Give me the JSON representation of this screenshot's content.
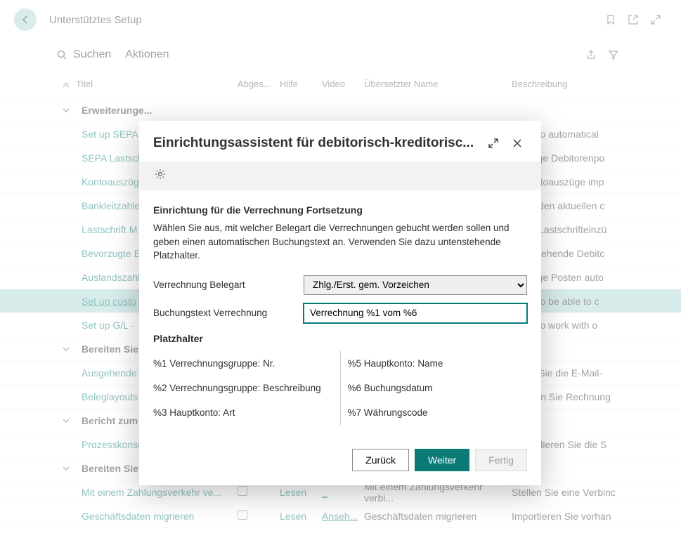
{
  "header": {
    "page_title": "Unterstütztes Setup"
  },
  "actionbar": {
    "search_label": "Suchen",
    "actions_label": "Aktionen"
  },
  "columns": {
    "title": "Titel",
    "abges": "Abges...",
    "hilfe": "Hilfe",
    "video": "Video",
    "uname": "Übersetzter Name",
    "beschr": "Beschreibung"
  },
  "groups": [
    {
      "label": "Erweiterunge..."
    },
    {
      "label": "Bereiten Sie s..."
    },
    {
      "label": "Bericht zum F..."
    },
    {
      "label": "Bereiten Sie s..."
    }
  ],
  "rows": {
    "sepa": {
      "title": "Set up SEPA (",
      "beschr": "order to automatical"
    },
    "sepa_last": {
      "title": "SEPA Lastsch",
      "beschr": "m fällige Debitorenpo"
    },
    "kontoausz": {
      "title": "Kontoauszüg",
      "beschr": "m Kontoauszüge imp"
    },
    "bankleit": {
      "title": "Bankleitzahle",
      "beschr": "m mit den aktuellen c"
    },
    "lastschrift": {
      "title": "Lastschrift M",
      "beschr": "m mit Lastschrifteinzü"
    },
    "bevorzugte": {
      "title": "Bevorzugte E",
      "beschr": "m bestehende Debitc"
    },
    "auslandszahl": {
      "title": "Auslandszahl",
      "beschr": "m fällige Posten auto"
    },
    "custo": {
      "title": "Set up custo",
      "beschr": "order to be able to c"
    },
    "gl": {
      "title": "Set up G/L -",
      "beschr": "order to work with o"
    },
    "ausgehende": {
      "title": "Ausgehende",
      "beschr": "chten Sie die E-Mail-"
    },
    "beleglayouts": {
      "title": "Beleglayouts",
      "beschr": "estalten Sie Rechnung"
    },
    "prozesskonso": {
      "title": "Prozesskonso",
      "beschr": "onsolidieren Sie die S"
    },
    "zahlungsverkehr": {
      "title": "Mit einem Zahlungsverkehr ve...",
      "hilfe": "Lesen",
      "video": "_",
      "uname": "Mit einem Zahlungsverkehr verbi...",
      "beschr": "Stellen Sie eine Verbinc"
    },
    "geschaeftsdaten": {
      "title": "Geschäftsdaten migrieren",
      "hilfe": "Lesen",
      "video": "Anseh...",
      "uname": "Geschäftsdaten migrieren",
      "beschr": "Importieren Sie vorhan"
    }
  },
  "modal": {
    "title": "Einrichtungsassistent für debitorisch-kreditorisc...",
    "section_heading": "Einrichtung für die Verrechnung Fortsetzung",
    "section_desc": "Wählen Sie aus, mit welcher Belegart die Verrechnungen gebucht werden sollen und geben einen automatischen Buchungstext an. Verwenden Sie dazu untenstehende Platzhalter.",
    "field1_label": "Verrechnung Belegart",
    "field1_value": "Zhlg./Erst. gem. Vorzeichen",
    "field2_label": "Buchungstext Verrechnung",
    "field2_value": "Verrechnung %1 vom %6",
    "ph_heading": "Platzhalter",
    "ph_left": [
      "%1 Verrechnungsgruppe: Nr.",
      "%2 Verrechnungsgruppe: Beschreibung",
      "%3 Hauptkonto: Art"
    ],
    "ph_right": [
      "%5 Hauptkonto: Name",
      "%6 Buchungsdatum",
      "%7 Währungscode"
    ],
    "btn_back": "Zurück",
    "btn_next": "Weiter",
    "btn_finish": "Fertig"
  }
}
